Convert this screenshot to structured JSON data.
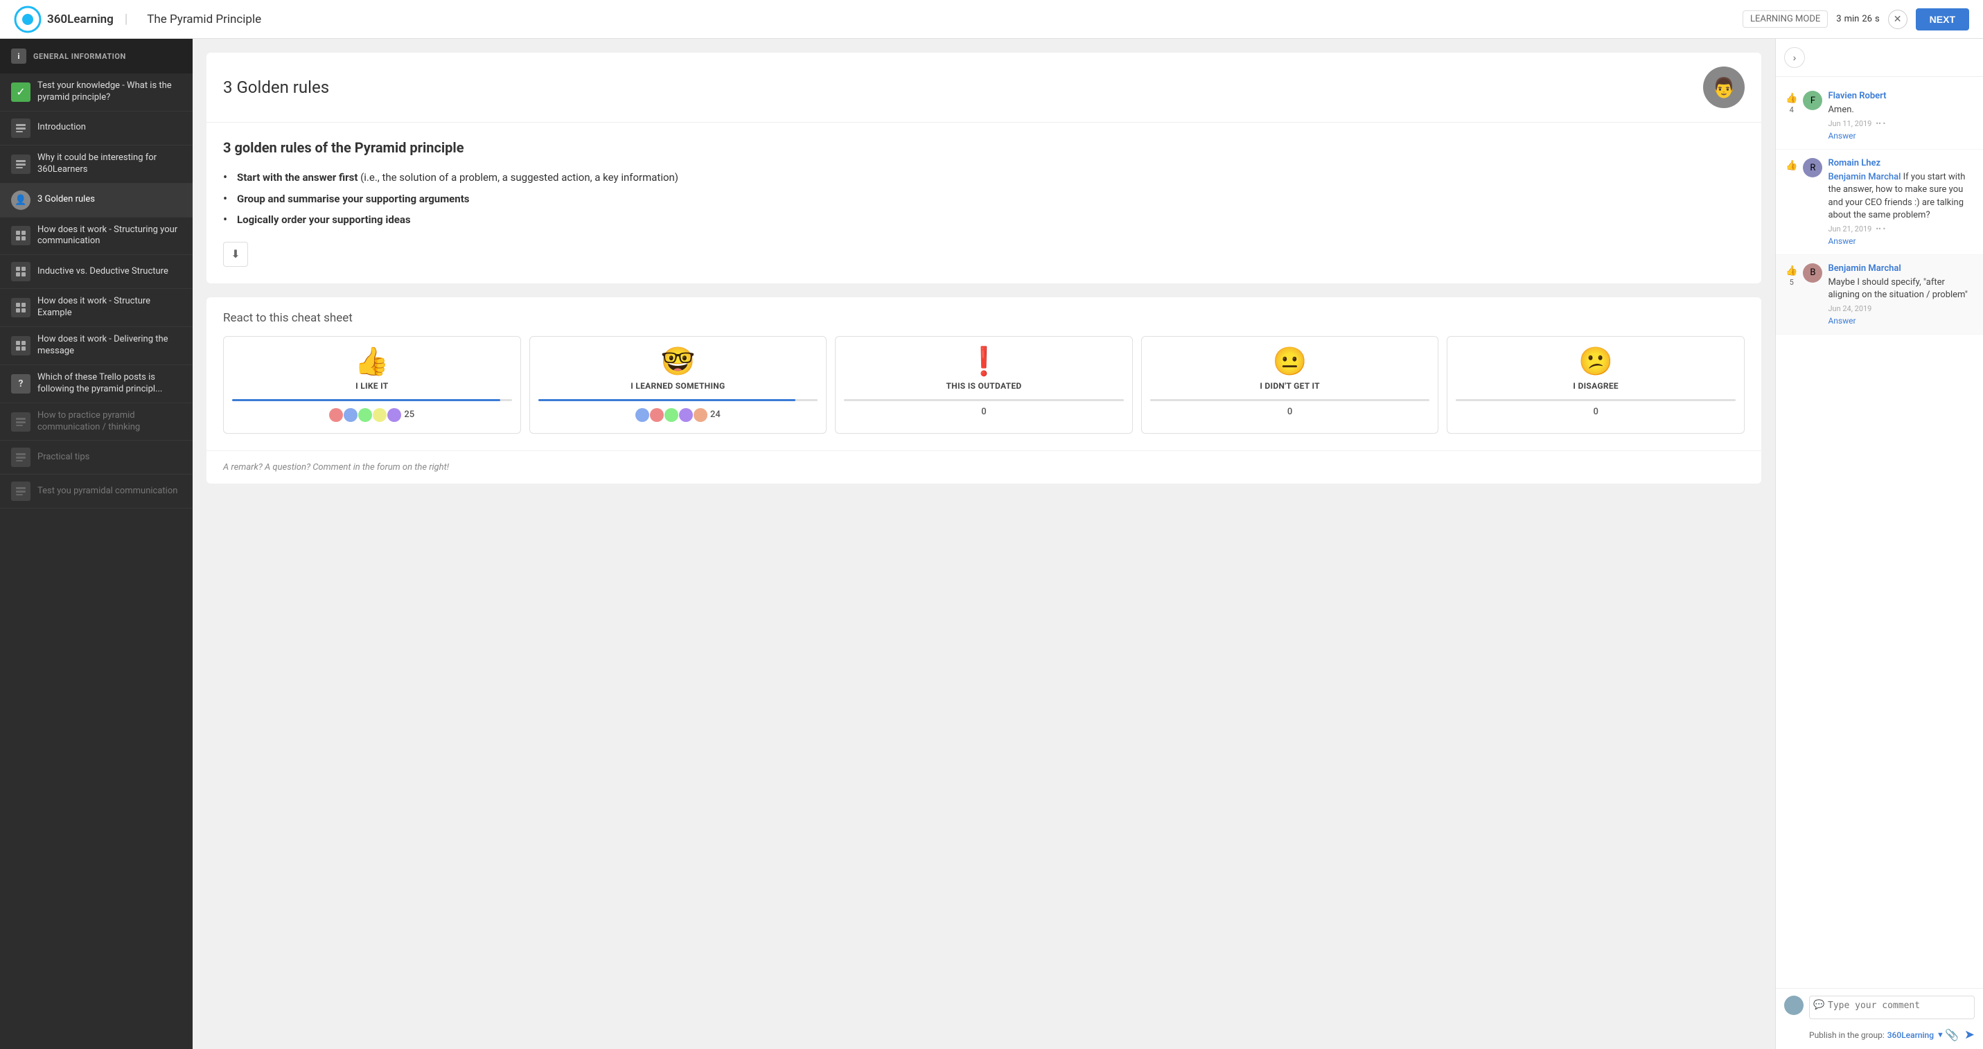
{
  "header": {
    "brand": "360Learning",
    "title": "The Pyramid Principle",
    "learning_mode_label": "LEARNING MODE",
    "timer": {
      "min": 3,
      "min_label": "min",
      "sec": 26,
      "sec_label": "s"
    },
    "next_label": "NEXT"
  },
  "sidebar": {
    "section_label": "GENERAL INFORMATION",
    "items": [
      {
        "id": "test-knowledge",
        "label": "Test your knowledge - What is the pyramid principle?",
        "type": "check",
        "active": false
      },
      {
        "id": "introduction",
        "label": "Introduction",
        "type": "module",
        "active": false
      },
      {
        "id": "why-interesting",
        "label": "Why it could be interesting for 360Learners",
        "type": "module",
        "active": false
      },
      {
        "id": "3-golden-rules",
        "label": "3 Golden rules",
        "type": "avatar",
        "active": true
      },
      {
        "id": "structuring",
        "label": "How does it work - Structuring your communication",
        "type": "module",
        "active": false
      },
      {
        "id": "inductive-deductive",
        "label": "Inductive vs. Deductive Structure",
        "type": "module",
        "active": false
      },
      {
        "id": "structure-example",
        "label": "How does it work - Structure Example",
        "type": "module",
        "active": false
      },
      {
        "id": "delivering",
        "label": "How does it work - Delivering the message",
        "type": "module",
        "active": false
      },
      {
        "id": "trello",
        "label": "Which of these Trello posts is following the pyramid principl...",
        "type": "question",
        "active": false
      },
      {
        "id": "practice",
        "label": "How to practice pyramid communication / thinking",
        "type": "module",
        "active": false,
        "dimmed": true
      },
      {
        "id": "practical-tips",
        "label": "Practical tips",
        "type": "module",
        "active": false,
        "dimmed": true
      },
      {
        "id": "test-pyramidal",
        "label": "Test you pyramidal communication",
        "type": "module",
        "active": false,
        "dimmed": true
      }
    ]
  },
  "main": {
    "card_title": "3 Golden rules",
    "content_title": "3 golden rules of the Pyramid principle",
    "bullets": [
      {
        "bold": "Start with the answer first",
        "rest": " (i.e., the solution of a problem, a suggested action, a key information)"
      },
      {
        "bold": "Group and summarise your supporting arguments",
        "rest": ""
      },
      {
        "bold": "Logically order your supporting ideas",
        "rest": ""
      }
    ],
    "download_label": "↓",
    "reactions_title": "React to this cheat sheet",
    "reactions": [
      {
        "id": "like",
        "emoji": "👍",
        "label": "I LIKE IT",
        "count": 25,
        "bar_pct": 96,
        "has_avatars": true
      },
      {
        "id": "learned",
        "emoji": "🤓",
        "label": "I LEARNED SOMETHING",
        "count": 24,
        "bar_pct": 92,
        "has_avatars": true
      },
      {
        "id": "outdated",
        "emoji": "❗",
        "label": "THIS IS OUTDATED",
        "count": 0,
        "bar_pct": 0,
        "has_avatars": false
      },
      {
        "id": "didnt-get",
        "emoji": "😐",
        "label": "I DIDN'T GET IT",
        "count": 0,
        "bar_pct": 0,
        "has_avatars": false
      },
      {
        "id": "disagree",
        "emoji": "😕",
        "label": "I DISAGREE",
        "count": 0,
        "bar_pct": 0,
        "has_avatars": false
      }
    ],
    "remark_text": "A remark? A question? Comment in the forum on the right!"
  },
  "comments": {
    "items": [
      {
        "author": "Flavien Robert",
        "text": "Amen.",
        "date": "Jun 11, 2019",
        "likes": 4,
        "mention": null,
        "reply_label": "Answer"
      },
      {
        "author": "Romain Lhez",
        "text": "If you start with the answer, how to make sure you and your CEO friends :) are talking about the same problem?",
        "date": "Jun 21, 2019",
        "likes": 0,
        "mention": "Benjamin Marchal",
        "reply_label": "Answer"
      },
      {
        "author": "Benjamin Marchal",
        "text": "Maybe I should specify, \"after aligning on the situation / problem\"",
        "date": "Jun 24, 2019",
        "likes": 5,
        "mention": null,
        "reply_label": "Answer"
      }
    ],
    "input_placeholder": "Type your comment",
    "publish_label": "Publish in the group:",
    "group_name": "360Learning"
  }
}
